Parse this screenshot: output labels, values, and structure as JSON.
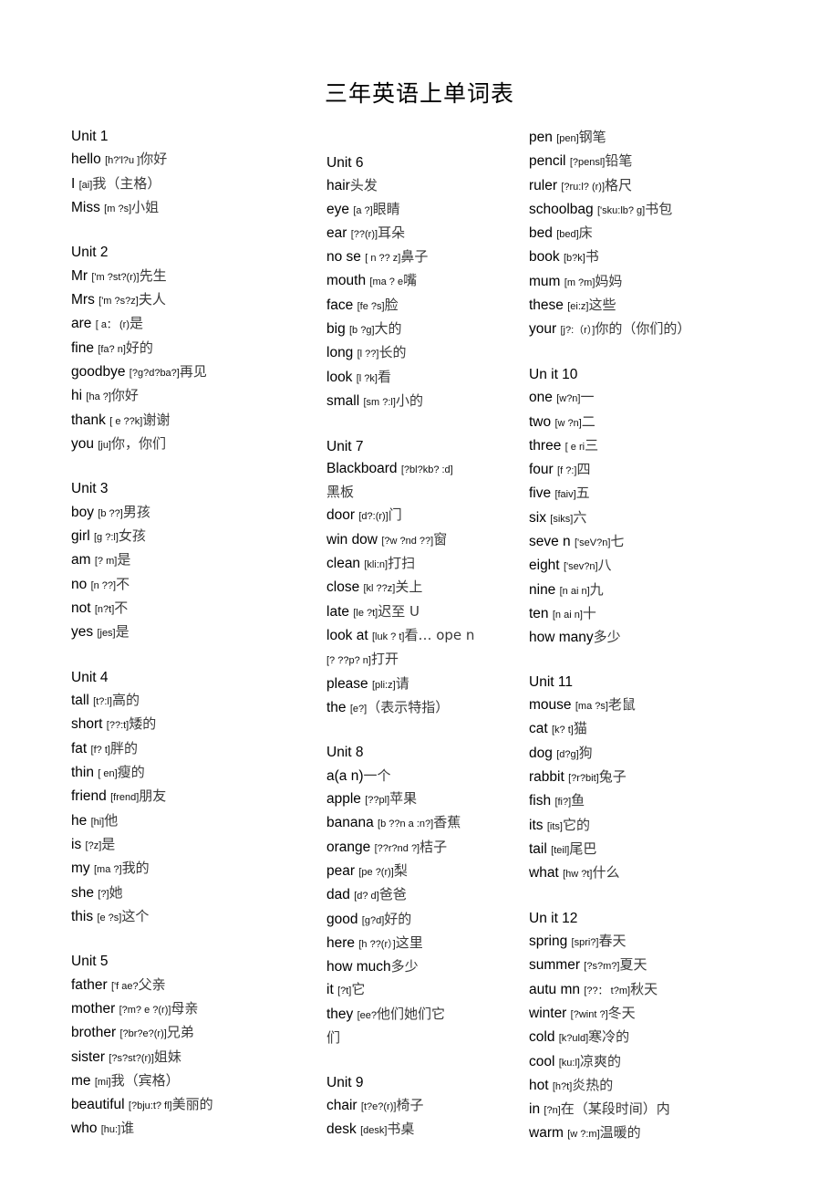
{
  "document": {
    "title": "三年英语上单词表"
  },
  "columns": [
    {
      "id": "column-1",
      "blocks": [
        {
          "type": "unit",
          "label": "Unit 1"
        },
        {
          "type": "entry",
          "word": "hello",
          "ipa": "[h?'l?u ]",
          "cn": "你好"
        },
        {
          "type": "entry",
          "word": "I",
          "ipa": "[ai]",
          "cn": "我（主格）"
        },
        {
          "type": "entry",
          "word": "Miss",
          "ipa": "[m ?s]",
          "cn": "小姐"
        },
        {
          "type": "gap"
        },
        {
          "type": "unit",
          "label": "Unit 2"
        },
        {
          "type": "entry",
          "word": "Mr",
          "ipa": "['m ?st?(r)]",
          "cn": "先生"
        },
        {
          "type": "entry",
          "word": "Mrs",
          "ipa": "['m ?s?z]",
          "cn": "夫人"
        },
        {
          "type": "entry",
          "word": "are",
          "ipa": "[ a： (r)",
          "cn": "是"
        },
        {
          "type": "entry",
          "word": "fine",
          "ipa": "[fa? n]",
          "cn": "好的"
        },
        {
          "type": "entry",
          "word": "goodbye",
          "ipa": "[?g?d?ba?]",
          "cn": "再见"
        },
        {
          "type": "entry",
          "word": "hi",
          "ipa": "[ha ?]",
          "cn": "你好"
        },
        {
          "type": "entry",
          "word": "thank",
          "ipa": "[ e ??k]",
          "cn": "谢谢"
        },
        {
          "type": "entry",
          "word": "you",
          "ipa": "[ju]",
          "cn": "你，你们"
        },
        {
          "type": "gap"
        },
        {
          "type": "unit",
          "label": "Unit 3"
        },
        {
          "type": "entry",
          "word": "boy",
          "ipa": "[b ??]",
          "cn": "男孩"
        },
        {
          "type": "entry",
          "word": "girl",
          "ipa": "[g ?:l]",
          "cn": "女孩"
        },
        {
          "type": "entry",
          "word": "am",
          "ipa": "[? m]",
          "cn": "是"
        },
        {
          "type": "entry",
          "word": "no",
          "ipa": "[n ??]",
          "cn": "不"
        },
        {
          "type": "entry",
          "word": "not",
          "ipa": "[n?t]",
          "cn": "不"
        },
        {
          "type": "entry",
          "word": "yes",
          "ipa": "[jes]",
          "cn": "是"
        },
        {
          "type": "gap"
        },
        {
          "type": "unit",
          "label": "Unit 4"
        },
        {
          "type": "entry",
          "word": "tall",
          "ipa": "[t?:l]",
          "cn": "高的"
        },
        {
          "type": "entry",
          "word": "short",
          "ipa": "[??:t]",
          "cn": "矮的"
        },
        {
          "type": "entry",
          "word": "fat",
          "ipa": "[f? t]",
          "cn": "胖的"
        },
        {
          "type": "entry",
          "word": "thin",
          "ipa": "[ en]",
          "cn": "瘦的"
        },
        {
          "type": "entry",
          "word": "friend",
          "ipa": "[frend]",
          "cn": "朋友"
        },
        {
          "type": "entry",
          "word": "he",
          "ipa": "[hi]",
          "cn": "他"
        },
        {
          "type": "entry",
          "word": "is",
          "ipa": "[?z]",
          "cn": "是"
        },
        {
          "type": "entry",
          "word": "my",
          "ipa": "[ma ?]",
          "cn": "我的"
        },
        {
          "type": "entry",
          "word": "she",
          "ipa": "[?]",
          "cn": "她"
        },
        {
          "type": "entry",
          "word": "this",
          "ipa": "[e ?s]",
          "cn": "这个"
        },
        {
          "type": "gap"
        },
        {
          "type": "unit",
          "label": "Unit 5"
        },
        {
          "type": "entry",
          "word": "father",
          "ipa": "['f ae?",
          "cn": "父亲"
        },
        {
          "type": "entry",
          "word": "mother",
          "ipa": "[?m? e ?(r)]",
          "cn": "母亲"
        },
        {
          "type": "entry",
          "word": "brother",
          "ipa": "[?br?e?(r)]",
          "cn": "兄弟"
        },
        {
          "type": "entry",
          "word": "sister",
          "ipa": "[?s?st?(r)]",
          "cn": "姐妹"
        },
        {
          "type": "entry",
          "word": "me",
          "ipa": "[mi]",
          "cn": "我（宾格）"
        },
        {
          "type": "entry",
          "word": "beautiful",
          "ipa": "[?bju:t? fl]",
          "cn": "美丽的"
        },
        {
          "type": "entry",
          "word": "who",
          "ipa": "[hu:]",
          "cn": "谁"
        }
      ]
    },
    {
      "id": "column-2",
      "blocks": [
        {
          "type": "unit",
          "label": "Unit 6"
        },
        {
          "type": "entry",
          "word": "hair",
          "ipa": "",
          "cn": "头发"
        },
        {
          "type": "entry",
          "word": "eye",
          "ipa": "[a ?]",
          "cn": "眼睛"
        },
        {
          "type": "entry",
          "word": "ear",
          "ipa": "[??(r)]",
          "cn": "耳朵"
        },
        {
          "type": "entry",
          "word": "no se",
          "ipa": "[ n ?? z]",
          "cn": "鼻子"
        },
        {
          "type": "entry",
          "word": "mouth",
          "ipa": "[ma ? e",
          "cn": "嘴"
        },
        {
          "type": "entry",
          "word": "face",
          "ipa": "[fe ?s]",
          "cn": "脸"
        },
        {
          "type": "entry",
          "word": "big",
          "ipa": "[b ?g]",
          "cn": "大的"
        },
        {
          "type": "entry",
          "word": "long",
          "ipa": "[l ??]",
          "cn": "长的"
        },
        {
          "type": "entry",
          "word": "look",
          "ipa": "[l ?k]",
          "cn": "看"
        },
        {
          "type": "entry",
          "word": "small",
          "ipa": "[sm ?:l]",
          "cn": "小的"
        },
        {
          "type": "gap"
        },
        {
          "type": "unit",
          "label": "Unit 7"
        },
        {
          "type": "entry",
          "word": "Blackboard",
          "ipa": "[?bl?kb? :d]",
          "cn": ""
        },
        {
          "type": "entry",
          "word": "",
          "ipa": "",
          "cn": "黑板"
        },
        {
          "type": "entry",
          "word": "door",
          "ipa": "[d?:(r)]",
          "cn": "门"
        },
        {
          "type": "entry",
          "word": "win dow",
          "ipa": "[?w ?nd ??]",
          "cn": "窗"
        },
        {
          "type": "entry",
          "word": "clean",
          "ipa": "[kli:n]",
          "cn": "打扫"
        },
        {
          "type": "entry",
          "word": "close",
          "ipa": "[kl ??z]",
          "cn": "关上"
        },
        {
          "type": "entry",
          "word": "late",
          "ipa": "[le ?t]",
          "cn": "迟至 U"
        },
        {
          "type": "entry",
          "word": "look at",
          "ipa": "[luk ? t]",
          "cn": "看…  ope n"
        },
        {
          "type": "entry",
          "word": "",
          "ipa": "[? ??p? n]",
          "cn": "打开"
        },
        {
          "type": "entry",
          "word": "please",
          "ipa": "[pli:z]",
          "cn": "请"
        },
        {
          "type": "entry",
          "word": "the",
          "ipa": "[e?]",
          "cn": "（表示特指）"
        },
        {
          "type": "gap"
        },
        {
          "type": "unit",
          "label": "Unit 8"
        },
        {
          "type": "entry",
          "word": "a(a n)",
          "ipa": "",
          "cn": "一个"
        },
        {
          "type": "entry",
          "word": "apple",
          "ipa": "[??pl]",
          "cn": "苹果"
        },
        {
          "type": "entry",
          "word": "banana",
          "ipa": "[b ??n a :n?]",
          "cn": "香蕉"
        },
        {
          "type": "entry",
          "word": "orange",
          "ipa": "[??r?nd ?]",
          "cn": "桔子"
        },
        {
          "type": "entry",
          "word": "pear",
          "ipa": "[pe ?(r)]",
          "cn": "梨"
        },
        {
          "type": "entry",
          "word": "dad",
          "ipa": "[d? d]",
          "cn": "爸爸"
        },
        {
          "type": "entry",
          "word": "good",
          "ipa": "[g?d]",
          "cn": "好的"
        },
        {
          "type": "entry",
          "word": "here",
          "ipa": "[h ??(r）]",
          "cn": "这里"
        },
        {
          "type": "entry",
          "word": "how much",
          "ipa": "",
          "cn": "多少"
        },
        {
          "type": "entry",
          "word": "it",
          "ipa": "[?t]",
          "cn": "它"
        },
        {
          "type": "entry",
          "word": "they",
          "ipa": "[ee?",
          "cn": "他们她们它"
        },
        {
          "type": "entry",
          "word": "",
          "ipa": "",
          "cn": "们"
        },
        {
          "type": "gap"
        },
        {
          "type": "unit",
          "label": "Unit 9"
        },
        {
          "type": "entry",
          "word": "chair",
          "ipa": "[t?e?(r)]",
          "cn": "椅子"
        },
        {
          "type": "entry",
          "word": "desk",
          "ipa": "[desk]",
          "cn": "书桌"
        }
      ]
    },
    {
      "id": "column-3",
      "blocks": [
        {
          "type": "entry",
          "word": " pen",
          "ipa": "[pen]",
          "cn": "钢笔"
        },
        {
          "type": "entry",
          "word": "pencil",
          "ipa": "[?pensl]",
          "cn": "铅笔"
        },
        {
          "type": "entry",
          "word": "ruler",
          "ipa": "[?ru:l? (r)]",
          "cn": "格尺"
        },
        {
          "type": "entry",
          "word": "schoolbag",
          "ipa": "['sku:lb? g]",
          "cn": "书包"
        },
        {
          "type": "entry",
          "word": "bed",
          "ipa": "[bed]",
          "cn": "床"
        },
        {
          "type": "entry",
          "word": "book",
          "ipa": "[b?k]",
          "cn": "书"
        },
        {
          "type": "entry",
          "word": "mum",
          "ipa": "[m ?m]",
          "cn": "妈妈"
        },
        {
          "type": "entry",
          "word": "these",
          "ipa": "[ei:z]",
          "cn": "这些"
        },
        {
          "type": "entry",
          "word": "your",
          "ipa": "[j?:（r）]",
          "cn": "你的（你们的）"
        },
        {
          "type": "gap"
        },
        {
          "type": "unit",
          "label": "Un it 10"
        },
        {
          "type": "entry",
          "word": "one",
          "ipa": "[w?n]",
          "cn": "一"
        },
        {
          "type": "entry",
          "word": "two",
          "ipa": "[w ?n]",
          "cn": "二"
        },
        {
          "type": "entry",
          "word": "three",
          "ipa": "[ e ri",
          "cn": "三"
        },
        {
          "type": "entry",
          "word": "four",
          "ipa": "[f ?:]",
          "cn": "四"
        },
        {
          "type": "entry",
          "word": "five",
          "ipa": "[faiv]",
          "cn": "五"
        },
        {
          "type": "entry",
          "word": "six",
          "ipa": "[siks]",
          "cn": "六"
        },
        {
          "type": "entry",
          "word": "seve n",
          "ipa": "['seV?n]",
          "cn": "七"
        },
        {
          "type": "entry",
          "word": "eight",
          "ipa": "['sev?n]",
          "cn": "八"
        },
        {
          "type": "entry",
          "word": "nine",
          "ipa": "[n ai n]",
          "cn": "九"
        },
        {
          "type": "entry",
          "word": "ten",
          "ipa": "[n ai n]",
          "cn": "十"
        },
        {
          "type": "entry",
          "word": "how many",
          "ipa": "",
          "cn": "多少"
        },
        {
          "type": "gap"
        },
        {
          "type": "unit",
          "label": "Unit 11"
        },
        {
          "type": "entry",
          "word": "mouse",
          "ipa": "[ma ?s]",
          "cn": "老鼠"
        },
        {
          "type": "entry",
          "word": "cat",
          "ipa": "[k? t]",
          "cn": "猫"
        },
        {
          "type": "entry",
          "word": "dog",
          "ipa": "[d?g]",
          "cn": "狗"
        },
        {
          "type": "entry",
          "word": "rabbit",
          "ipa": "[?r?bit]",
          "cn": "兔子"
        },
        {
          "type": "entry",
          "word": "fish",
          "ipa": "[fi?]",
          "cn": "鱼"
        },
        {
          "type": "entry",
          "word": "its",
          "ipa": "[its]",
          "cn": "它的"
        },
        {
          "type": "entry",
          "word": "tail",
          "ipa": "[teil]",
          "cn": "尾巴"
        },
        {
          "type": "entry",
          "word": "what",
          "ipa": "[hw ?t]",
          "cn": "什么"
        },
        {
          "type": "gap"
        },
        {
          "type": "unit",
          "label": "Un it 12"
        },
        {
          "type": "entry",
          "word": "spring",
          "ipa": "[spri?]",
          "cn": "春天"
        },
        {
          "type": "entry",
          "word": "summer",
          "ipa": "[?s?m?]",
          "cn": "夏天"
        },
        {
          "type": "entry",
          "word": "autu mn",
          "ipa": "[??： t?m]",
          "cn": "秋天"
        },
        {
          "type": "entry",
          "word": "winter",
          "ipa": "[?wint ?]",
          "cn": "冬天"
        },
        {
          "type": "entry",
          "word": "cold",
          "ipa": "[k?uld]",
          "cn": "寒冷的"
        },
        {
          "type": "entry",
          "word": "cool",
          "ipa": "[ku:l]",
          "cn": "凉爽的"
        },
        {
          "type": "entry",
          "word": "hot",
          "ipa": "[h?t]",
          "cn": "炎热的"
        },
        {
          "type": "entry",
          "word": "in",
          "ipa": "[?n]",
          "cn": "在（某段时间）内"
        },
        {
          "type": "entry",
          "word": "warm",
          "ipa": "[w ?:m]",
          "cn": "温暖的"
        }
      ]
    }
  ]
}
